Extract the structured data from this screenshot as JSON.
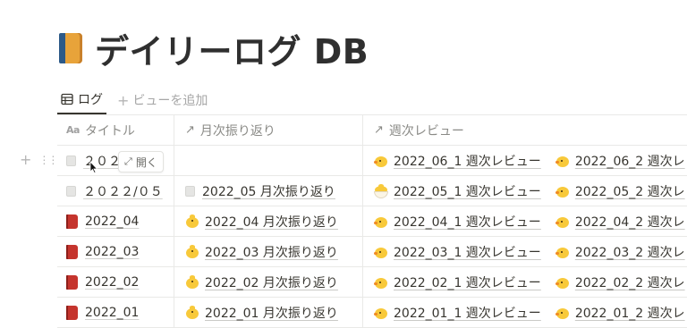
{
  "page": {
    "title": "デイリーログ DB",
    "icon": "orange-book-icon"
  },
  "tabs": [
    {
      "label": "ログ",
      "icon": "table-icon",
      "active": true
    },
    {
      "label": "ビューを追加",
      "icon": "plus-icon",
      "active": false
    }
  ],
  "columns": [
    {
      "label": "タイトル",
      "icon": "text-aa-icon"
    },
    {
      "label": "月次振り返り",
      "icon": "relation-arrow-icon"
    },
    {
      "label": "週次レビュー",
      "icon": "relation-arrow-icon"
    }
  ],
  "hover_row": {
    "open_label": "開く",
    "add_icon": "plus-icon",
    "drag_icon": "drag-handle-icon"
  },
  "rows": [
    {
      "title": "2022/06",
      "title_visible": "２０２",
      "title_icon": "document-icon",
      "monthly": "",
      "monthly_icon": "",
      "weekly": [
        {
          "label": "2022_06_1 週次レビュー",
          "icon": "chick-icon"
        },
        {
          "label": "2022_06_2 週次レ",
          "icon": "chick-icon"
        }
      ]
    },
    {
      "title": "２０２２/０５",
      "title_icon": "document-icon",
      "monthly": "2022_05 月次振り返り",
      "monthly_icon": "document-icon",
      "weekly": [
        {
          "label": "2022_05_1 週次レビュー",
          "icon": "hatching-chick-icon"
        },
        {
          "label": "2022_05_2 週次レ",
          "icon": "chick-icon"
        }
      ]
    },
    {
      "title": "2022_04",
      "title_icon": "red-book-icon",
      "monthly": "2022_04 月次振り返り",
      "monthly_icon": "baby-chick-icon",
      "weekly": [
        {
          "label": "2022_04_1 週次レビュー",
          "icon": "chick-icon"
        },
        {
          "label": "2022_04_2 週次レ",
          "icon": "chick-icon"
        }
      ]
    },
    {
      "title": "2022_03",
      "title_icon": "red-book-icon",
      "monthly": "2022_03 月次振り返り",
      "monthly_icon": "baby-chick-icon",
      "weekly": [
        {
          "label": "2022_03_1 週次レビュー",
          "icon": "chick-icon"
        },
        {
          "label": "2022_03_2 週次レ",
          "icon": "chick-icon"
        }
      ]
    },
    {
      "title": "2022_02",
      "title_icon": "red-book-icon",
      "monthly": "2022_02 月次振り返り",
      "monthly_icon": "baby-chick-icon",
      "weekly": [
        {
          "label": "2022_02_1 週次レビュー",
          "icon": "chick-icon"
        },
        {
          "label": "2022_02_2 週次レ",
          "icon": "chick-icon"
        }
      ]
    },
    {
      "title": "2022_01",
      "title_icon": "red-book-icon",
      "monthly": "2022_01 月次振り返り",
      "monthly_icon": "baby-chick-icon",
      "weekly": [
        {
          "label": "2022_01_1 週次レビュー",
          "icon": "chick-icon"
        },
        {
          "label": "2022_01_2 週次レ",
          "icon": "chick-icon"
        }
      ]
    }
  ]
}
